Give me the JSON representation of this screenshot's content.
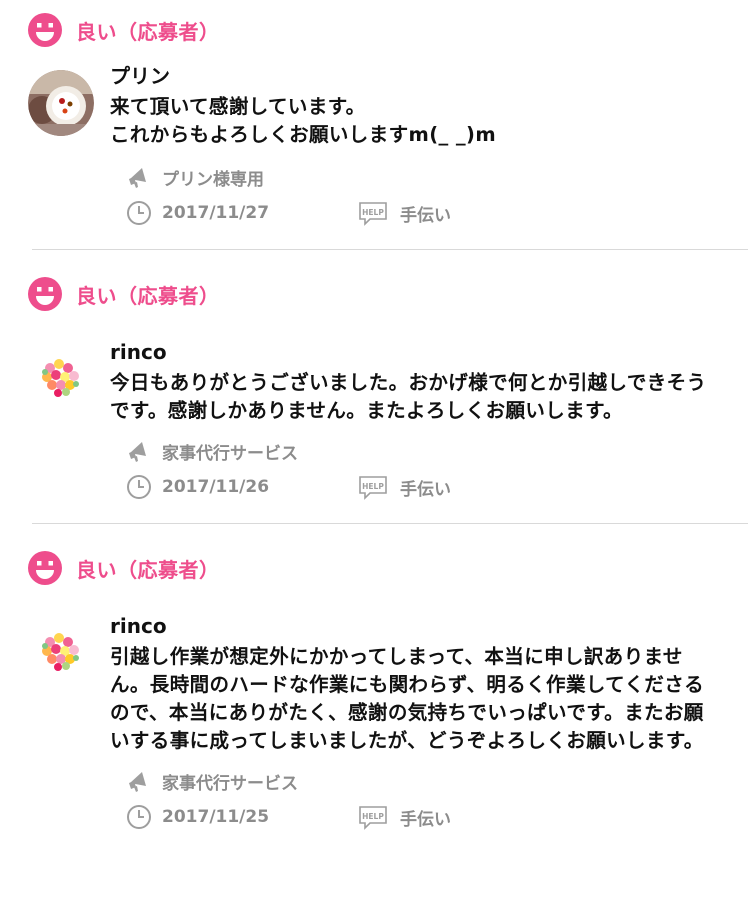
{
  "reviews": [
    {
      "rating": "良い（応募者）",
      "author": "プリン",
      "message": "来て頂いて感謝しています。\nこれからもよろしくお願いしますm(_ _)m",
      "service": "プリン様専用",
      "date": "2017/11/27",
      "help_label": "HELP",
      "category": "手伝い",
      "avatar_icon": "pudding-photo-avatar"
    },
    {
      "rating": "良い（応募者）",
      "author": "rinco",
      "message": "今日もありがとうございました。おかげ様で何とか引越しできそうです。感謝しかありません。またよろしくお願いします。",
      "service": "家事代行サービス",
      "date": "2017/11/26",
      "help_label": "HELP",
      "category": "手伝い",
      "avatar_icon": "flower-bouquet-avatar"
    },
    {
      "rating": "良い（応募者）",
      "author": "rinco",
      "message": "引越し作業が想定外にかかってしまって、本当に申し訳ありません。長時間のハードな作業にも関わらず、明るく作業してくださるので、本当にありがたく、感謝の気持ちでいっぱいです。またお願いする事に成ってしまいましたが、どうぞよろしくお願いします。",
      "service": "家事代行サービス",
      "date": "2017/11/25",
      "help_label": "HELP",
      "category": "手伝い",
      "avatar_icon": "flower-bouquet-avatar"
    }
  ],
  "colors": {
    "accent": "#ee4d8c",
    "meta_text": "#8c8c8c",
    "divider": "#d9d9d9"
  }
}
